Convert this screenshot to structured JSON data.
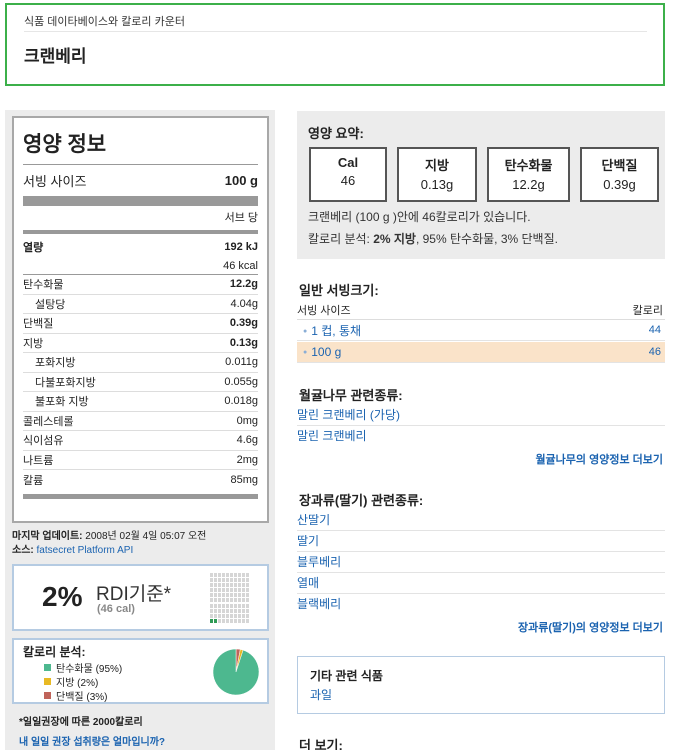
{
  "header": {
    "breadcrumb": "식품 데이타베이스와 칼로리 카운터",
    "title": "크랜베리"
  },
  "nutrition": {
    "title": "영양 정보",
    "serving_label": "서빙 사이즈",
    "serving_value": "100 g",
    "per_label": "서브 당",
    "energy_label": "열량",
    "energy_kj": "192 kJ",
    "energy_kcal": "46 kcal",
    "rows": [
      {
        "label": "탄수화물",
        "value": "12.2g"
      },
      {
        "label": "설탕당",
        "value": "4.04g"
      },
      {
        "label": "단백질",
        "value": "0.39g"
      },
      {
        "label": "지방",
        "value": "0.13g"
      },
      {
        "label": "포화지방",
        "value": "0.011g"
      },
      {
        "label": "다불포화지방",
        "value": "0.055g"
      },
      {
        "label": "불포화 지방",
        "value": "0.018g"
      },
      {
        "label": "콜레스테롤",
        "value": "0mg"
      },
      {
        "label": "식이섬유",
        "value": "4.6g"
      },
      {
        "label": "나트륨",
        "value": "2mg"
      },
      {
        "label": "칼륨",
        "value": "85mg"
      }
    ]
  },
  "update": {
    "label": "마지막 업데이트:",
    "date": "2008년 02월 4일 05:07 오전",
    "source_label": "소스:",
    "source_link": "fatsecret Platform API"
  },
  "rdi": {
    "percent": "2%",
    "label": "RDI기준*",
    "calories": "(46 cal)",
    "fraction": 0.02
  },
  "breakdown": {
    "title": "칼로리 분석:",
    "items": [
      {
        "label": "탄수화물 (95%)",
        "color": "#4db88f"
      },
      {
        "label": "지방 (2%)",
        "color": "#e8b923"
      },
      {
        "label": "단백질 (3%)",
        "color": "#c0645a"
      }
    ],
    "carb_pct": 95,
    "fat_pct": 2,
    "protein_pct": 3
  },
  "notes": {
    "rdi_note": "*일일권장에 따른 2000칼로리",
    "rdi_link": "내 일일 권장 섭취량은 얼마입니까?"
  },
  "summary": {
    "title": "영양 요약:",
    "boxes": [
      {
        "label": "Cal",
        "value": "46"
      },
      {
        "label": "지방",
        "value": "0.13g"
      },
      {
        "label": "탄수화물",
        "value": "12.2g"
      },
      {
        "label": "단백질",
        "value": "0.39g"
      }
    ],
    "line1": "크랜베리 (100 g )안에 46칼로리가 있습니다.",
    "line2_prefix": "칼로리 분석: ",
    "line2_bold": "2% 지방",
    "line2_rest": ", 95% 탄수화물, 3% 단백질."
  },
  "servings": {
    "title": "일반 서빙크기:",
    "col_size": "서빙 사이즈",
    "col_cal": "칼로리",
    "rows": [
      {
        "size": "1 컵, 통채",
        "cal": "44"
      },
      {
        "size": "100 g",
        "cal": "46"
      }
    ]
  },
  "related1": {
    "title": "월귤나무 관련종류:",
    "items": [
      "말린 크랜베리 (가당)",
      "말린 크랜베리"
    ],
    "more": "월귤나무의 영양정보 더보기"
  },
  "related2": {
    "title": "장과류(딸기) 관련종류:",
    "items": [
      "산딸기",
      "딸기",
      "블루베리",
      "열매",
      "블랙베리"
    ],
    "more": "장과류(딸기)의 영양정보 더보기"
  },
  "other": {
    "title": "기타 관련 식품",
    "link": "과일"
  },
  "see_more": "더 보기:"
}
